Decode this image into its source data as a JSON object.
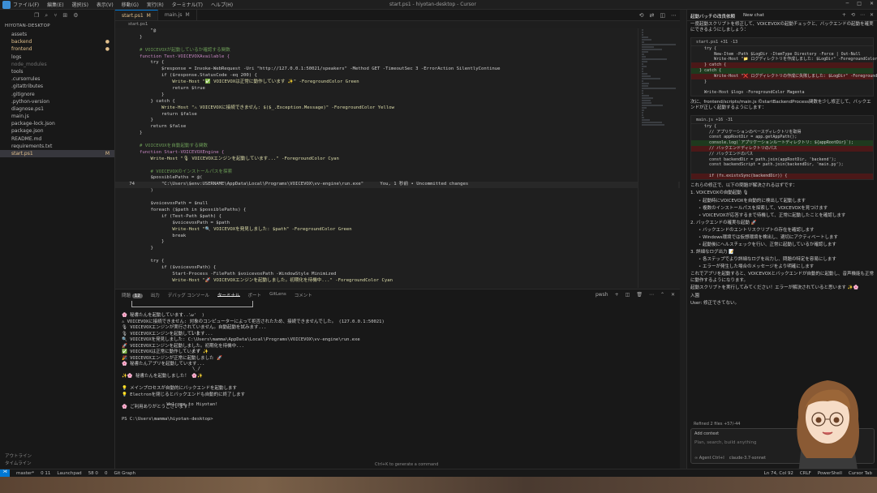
{
  "titlebar": {
    "menu": [
      "ファイル(F)",
      "編集(E)",
      "選択(S)",
      "表示(V)",
      "移動(G)",
      "実行(R)",
      "ターミナル(T)",
      "ヘルプ(H)"
    ],
    "title": "start.ps1 - hiyotan-desktop - Cursor"
  },
  "sidebar": {
    "header": "HIYOTAN-DESKTOP",
    "items": [
      {
        "label": "assets",
        "type": "fold"
      },
      {
        "label": "backend",
        "type": "mod",
        "badge": "●"
      },
      {
        "label": "frontend",
        "type": "mod",
        "badge": "●"
      },
      {
        "label": "logs",
        "type": "fold"
      },
      {
        "label": "node_modules",
        "type": "dim"
      },
      {
        "label": "tools",
        "type": "fold"
      },
      {
        "label": ".cursorrules",
        "type": "fold"
      },
      {
        "label": ".gitattributes",
        "type": "fold"
      },
      {
        "label": ".gitignore",
        "type": "fold"
      },
      {
        "label": ".python-version",
        "type": "fold"
      },
      {
        "label": "diagnose.ps1",
        "type": "fold"
      },
      {
        "label": "main.js",
        "type": "fold"
      },
      {
        "label": "package-lock.json",
        "type": "fold"
      },
      {
        "label": "package.json",
        "type": "fold"
      },
      {
        "label": "README.md",
        "type": "fold"
      },
      {
        "label": "requirements.txt",
        "type": "fold"
      },
      {
        "label": "start.ps1",
        "type": "sel",
        "badge": "M"
      }
    ],
    "bottom": [
      "アウトライン",
      "タイムライン"
    ]
  },
  "tabs": [
    {
      "label": "start.ps1",
      "flag": "M",
      "active": true
    },
    {
      "label": "main.js",
      "flag": "M",
      "active": false
    }
  ],
  "breadcrumb": "start.ps1",
  "editor": {
    "lines": [
      {
        "n": "",
        "t": "    \"@"
      },
      {
        "n": "",
        "t": "}"
      },
      {
        "n": "",
        "t": ""
      },
      {
        "n": "",
        "t": "# VOICEVOXが起動しているか確認する関数"
      },
      {
        "n": "",
        "t": "function Test-VOICEVOXAvailable {"
      },
      {
        "n": "",
        "t": "    try {"
      },
      {
        "n": "",
        "t": "        $response = Invoke-WebRequest -Uri \"http://127.0.0.1:50021/speakers\" -Method GET -TimeoutSec 3 -ErrorAction SilentlyContinue"
      },
      {
        "n": "",
        "t": "        if ($response.StatusCode -eq 200) {"
      },
      {
        "n": "",
        "t": "            Write-Host \"✅ VOICEVOXは正常に動作しています ✨\" -ForegroundColor Green"
      },
      {
        "n": "",
        "t": "            return $true"
      },
      {
        "n": "",
        "t": "        }"
      },
      {
        "n": "",
        "t": "    } catch {"
      },
      {
        "n": "",
        "t": "        Write-Host \"⚠ VOICEVOXに接続できません: $($_.Exception.Message)\" -ForegroundColor Yellow"
      },
      {
        "n": "",
        "t": "        return $false"
      },
      {
        "n": "",
        "t": "    }"
      },
      {
        "n": "",
        "t": "    return $false"
      },
      {
        "n": "",
        "t": "}"
      },
      {
        "n": "",
        "t": ""
      },
      {
        "n": "",
        "t": "# VOICEVOXを自動起動する関数"
      },
      {
        "n": "",
        "t": "function Start-VOICEVOXEngine {"
      },
      {
        "n": "",
        "t": "    Write-Host \"🎙 VOICEVOXエンジンを起動しています...\" -ForegroundColor Cyan"
      },
      {
        "n": "",
        "t": ""
      },
      {
        "n": "",
        "t": "    # VOICEVOXのインストールパスを探索"
      },
      {
        "n": "",
        "t": "    $possiblePaths = @("
      },
      {
        "n": "74",
        "t": "        \"C:\\Users\\$env:USERNAME\\AppData\\Local\\Programs\\VOICEVOX\\vv-engine\\run.exe\"      You, 1 秒前 • Uncommitted changes",
        "cur": true
      },
      {
        "n": "",
        "t": "    )"
      },
      {
        "n": "",
        "t": ""
      },
      {
        "n": "",
        "t": "    $voicevoxPath = $null"
      },
      {
        "n": "",
        "t": "    foreach ($path in $possiblePaths) {"
      },
      {
        "n": "",
        "t": "        if (Test-Path $path) {"
      },
      {
        "n": "",
        "t": "            $voicevoxPath = $path"
      },
      {
        "n": "",
        "t": "            Write-Host \"🔍 VOICEVOXを発見しました: $path\" -ForegroundColor Green"
      },
      {
        "n": "",
        "t": "            break"
      },
      {
        "n": "",
        "t": "        }"
      },
      {
        "n": "",
        "t": "    }"
      },
      {
        "n": "",
        "t": ""
      },
      {
        "n": "",
        "t": "    try {"
      },
      {
        "n": "",
        "t": "        if ($voicevoxPath) {"
      },
      {
        "n": "",
        "t": "            Start-Process -FilePath $voicevoxPath -WindowStyle Minimized"
      },
      {
        "n": "",
        "t": "            Write-Host \"🚀 VOICEVOXエンジンを起動しました。初期化を待機中...\" -ForegroundColor Cyan"
      }
    ]
  },
  "panel": {
    "tabs": [
      "問題",
      "出力",
      "デバッグ コンソール",
      "ターミナル",
      "ポート",
      "GitLens",
      "コメント"
    ],
    "problems_count": "12",
    "shell": "pwsh",
    "ascii": [
      "(  'ω'  )",
      "  ] [",
      "  _/ /",
      "   \\_/",
      "",
      "Welcome to Hiyotan!"
    ],
    "lines": [
      "🌸 秘書たんを起動しています...",
      "⚠ VOICEVOXに接続できません: 対象のコンピューターによって拒否されたため、接続できませんでした。 (127.0.0.1:50021)",
      "🎙 VOICEVOXエンジンが実行されていません。自動起動を試みます...",
      "🎙 VOICEVOXエンジンを起動しています...",
      "🔍 VOICEVOXを発見しました: C:\\Users\\mamma\\AppData\\Local\\Programs\\VOICEVOX\\vv-engine\\run.exe",
      "🚀 VOICEVOXエンジンを起動しました。初期化を待機中...",
      "✅ VOICEVOXは正常に動作しています ✨",
      "🎉 VOICEVOXエンジンが正常に起動しました 🚀",
      "🌸 秘書たんアプリを起動しています...",
      "",
      "✨🌸 秘書たんを起動しました！ 🌸✨",
      "",
      "💡 メインプロセスが自動的にバックエンドを起動します",
      "💡 Electronを閉じるとバックエンドも自動的に終了します",
      "",
      "🌸 ご利用ありがとうございます！",
      "",
      "PS C:\\Users\\mamma\\hiyotan-desktop> "
    ],
    "hint": "Ctrl+K to generate a command"
  },
  "chat": {
    "tabs": [
      "起動バッチの改良依頼",
      "New chat"
    ],
    "p1": "一度起動スクリプトを修正して、VOICEVOXの起動チェックと、バックエンドの起動を確実にできるようにしましょう：",
    "code1_head": "start.ps1 +31 -13",
    "code1": [
      {
        "t": "    try {",
        "c": ""
      },
      {
        "t": "        New-Item -Path $LogDir -ItemType Directory -Force | Out-Null",
        "c": ""
      },
      {
        "t": "        Write-Host \"📁 ログディレクトリを作成しました: $LogDir\" -ForegroundColor",
        "c": ""
      },
      {
        "t": "    } catch {",
        "c": "del"
      },
      {
        "t": "  } catch {",
        "c": "add"
      },
      {
        "t": "        Write-Host \"❌ ログディレクトリの作成に失敗しました: $LogDir\" -Foreground",
        "c": "del"
      },
      {
        "t": "    }",
        "c": ""
      },
      {
        "t": "",
        "c": ""
      },
      {
        "t": "    Write-Host $logo -ForegroundColor Magenta",
        "c": ""
      }
    ],
    "p2": "次に、frontend/scripts/main.js のstartBackendProcess関数を少し修正して、バックエンドが正しく起動するようにします：",
    "code2_head": "main.js +16 -31",
    "code2": [
      {
        "t": "    try {",
        "c": ""
      },
      {
        "t": "      // アプリケーションのベースディレクトリを取得",
        "c": ""
      },
      {
        "t": "      const appRootDir = app.getAppPath();",
        "c": ""
      },
      {
        "t": "      console.log(`アプリケーションルートディレクトリ: ${appRootDir}`);",
        "c": "add"
      },
      {
        "t": "      // バックエンドディレクトリのパス",
        "c": "del"
      },
      {
        "t": "      // バックエンドのパス",
        "c": ""
      },
      {
        "t": "      const backendDir = path.join(appRootDir, 'backend');",
        "c": ""
      },
      {
        "t": "      const backendScript = path.join(backendDir, 'main.py');",
        "c": ""
      },
      {
        "t": "",
        "c": ""
      },
      {
        "t": "      if (fs.existsSync(backendDir)) {",
        "c": "del"
      }
    ],
    "p3": "これらの修正で、以下の問題が解決されるはずです：",
    "h1": "1. VOICEVOXの自動起動 🎙",
    "l1": [
      "起動時にVOICEVOXを自動的に検出して起動します",
      "複数のインストールパスを探索して、VOICEVOXを見つけます",
      "VOICEVOXが応答するまで待機して、正常に起動したことを確認します"
    ],
    "h2": "2. バックエンドの確実な起動 🚀",
    "l2": [
      "バックエンドのエントリスクリプトの存在を確認します",
      "Windows環境では仮想環境を検出し、適切にアクティベートします",
      "起動後にヘルスチェックを行い、正常に起動しているか確認します"
    ],
    "h3": "3. 詳細なログ出力 📝",
    "l3": [
      "各ステップでより詳細なログを出力し、問題の特定を容易にします",
      "エラーが発生した場合のメッセージをより明確にします"
    ],
    "p4": "これでアプリを起動すると、VOICEVOXとバックエンドが自動的に起動し、音声機能も正常に動作するようになります。",
    "p5": "起動スクリプトを実行してみてください！エラーが解決されていると思います ✨🌸",
    "p6": "入園",
    "p7": "User: 修正できてない。",
    "review": "Refined 2 files  +57/-44",
    "ctx": "Add context",
    "placeholder": "Plan, search, build anything",
    "agent": "∞ Agent  Ctrl+I",
    "model": "claude-3.7-sonnet",
    "send": "Send"
  },
  "statusbar": {
    "items": [
      "master*",
      "0  11",
      "Launchpad",
      "58  0",
      "0",
      "Git Graph"
    ],
    "right": [
      "Ln 74, Col 92",
      "CRLF",
      "PowerShell",
      "Cursor Tab"
    ]
  }
}
